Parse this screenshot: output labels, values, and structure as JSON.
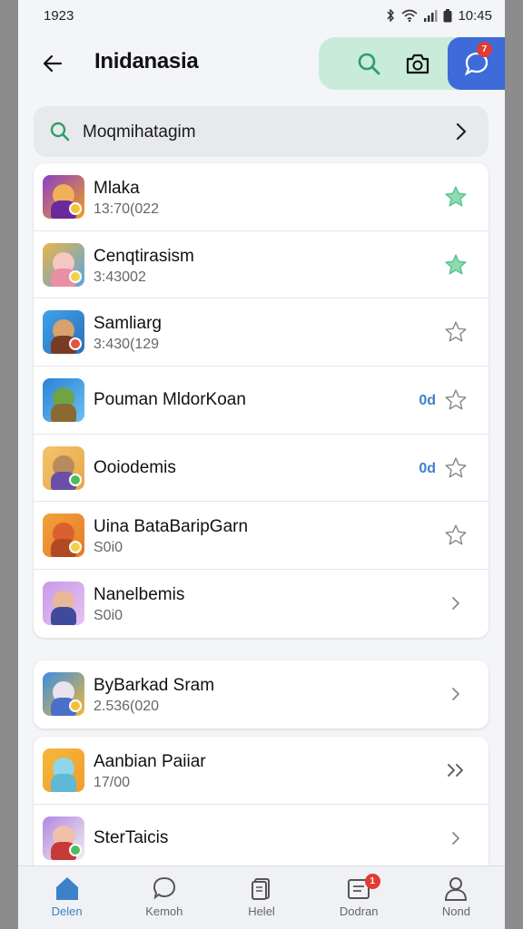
{
  "status": {
    "time": "1923",
    "clock": "10:45"
  },
  "header": {
    "title": "Inidanasia",
    "chat_badge": "7"
  },
  "search": {
    "text": "Moqmihatagim"
  },
  "list_primary": [
    {
      "title": "Mlaka",
      "subtitle": "13:70(022",
      "tag": "",
      "trailing": "star-filled-icon"
    },
    {
      "title": "Cenqtirasism",
      "subtitle": "3:43002",
      "tag": "",
      "trailing": "star-filled-icon"
    },
    {
      "title": "Samliarg",
      "subtitle": "3:430(129",
      "tag": "",
      "trailing": "star-outline-icon"
    },
    {
      "title": "Pouman MldorKoan",
      "subtitle": "",
      "tag": "0d",
      "trailing": "star-outline-icon"
    },
    {
      "title": "Ooiodemis",
      "subtitle": "",
      "tag": "0d",
      "trailing": "star-outline-icon"
    },
    {
      "title": "Uina BataBaripGarn",
      "subtitle": "S0i0",
      "tag": "",
      "trailing": "star-outline-icon"
    },
    {
      "title": "Nanelbemis",
      "subtitle": "S0i0",
      "tag": "",
      "trailing": "chevron-right-icon"
    }
  ],
  "list_single": [
    {
      "title": "ByBarkad Sram",
      "subtitle": "2.536(020",
      "trailing": "chevron-right-icon"
    }
  ],
  "list_secondary": [
    {
      "title": "Aanbian Paiiar",
      "subtitle": "17/00",
      "trailing": "double-chevron-icon"
    },
    {
      "title": "SterTaicis",
      "subtitle": "",
      "trailing": "chevron-right-icon"
    }
  ],
  "nav": [
    {
      "label": "Delen",
      "icon": "home-icon",
      "active": true
    },
    {
      "label": "Kemoh",
      "icon": "chat-icon",
      "active": false
    },
    {
      "label": "Helel",
      "icon": "cards-icon",
      "active": false
    },
    {
      "label": "Dodran",
      "icon": "inbox-icon",
      "active": false,
      "badge": "1"
    },
    {
      "label": "Nond",
      "icon": "profile-icon",
      "active": false
    }
  ],
  "colors": {
    "accent": "#3d82c9",
    "pill": "#c8ecd9",
    "chat": "#3d6bd8",
    "star_filled": "#5cc48c",
    "badge": "#e23b33"
  }
}
